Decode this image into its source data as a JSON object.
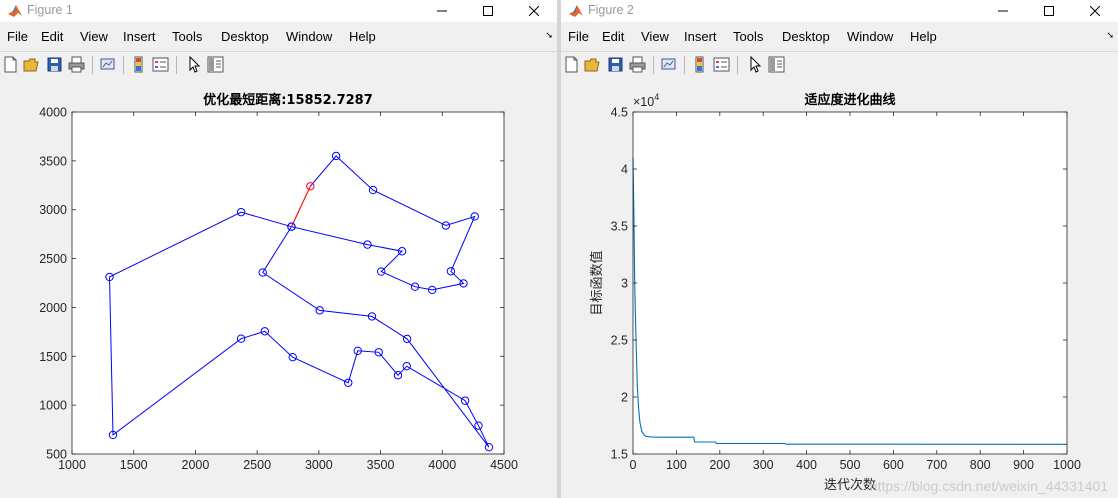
{
  "colors": {
    "route": "#0000ff",
    "route_highlight": "#ff0000",
    "curve": "#0072bd"
  },
  "figure1": {
    "title": "Figure 1",
    "menu": [
      "File",
      "Edit",
      "View",
      "Insert",
      "Tools",
      "Desktop",
      "Window",
      "Help"
    ]
  },
  "figure2": {
    "title": "Figure 2",
    "menu": [
      "File",
      "Edit",
      "View",
      "Insert",
      "Tools",
      "Desktop",
      "Window",
      "Help"
    ]
  },
  "toolbar_icons": [
    "new-figure-icon",
    "open-file-icon",
    "save-icon",
    "print-icon",
    "link-plot-icon",
    "colorbar-icon",
    "legend-icon",
    "pointer-icon",
    "property-inspector-icon"
  ],
  "watermark": "https://blog.csdn.net/weixin_44331401",
  "chart_data": [
    {
      "type": "scatter",
      "title": "优化最短距离:15852.7287",
      "xlabel": "",
      "ylabel": "",
      "xlim": [
        1000,
        4500
      ],
      "ylim": [
        500,
        4000
      ],
      "xticks": [
        1000,
        1500,
        2000,
        2500,
        3000,
        3500,
        4000,
        4500
      ],
      "yticks": [
        500,
        1000,
        1500,
        2000,
        2500,
        3000,
        3500,
        4000
      ],
      "grid": false,
      "route": [
        [
          2778,
          2826
        ],
        [
          2370,
          2975
        ],
        [
          1304,
          2312
        ],
        [
          1332,
          695
        ],
        [
          2370,
          1680
        ],
        [
          2562,
          1756
        ],
        [
          2788,
          1491
        ],
        [
          3238,
          1229
        ],
        [
          3315,
          1556
        ],
        [
          3485,
          1541
        ],
        [
          3641,
          1306
        ],
        [
          3712,
          1399
        ],
        [
          4185,
          1046
        ],
        [
          4293,
          790
        ],
        [
          4378,
          570
        ],
        [
          3715,
          1678
        ],
        [
          3430,
          1908
        ],
        [
          3007,
          1970
        ],
        [
          2545,
          2357
        ],
        [
          2778,
          2826
        ],
        [
          3394,
          2643
        ],
        [
          3674,
          2575
        ],
        [
          3505,
          2367
        ],
        [
          3779,
          2212
        ],
        [
          3918,
          2179
        ],
        [
          4172,
          2246
        ],
        [
          4070,
          2370
        ],
        [
          4263,
          2931
        ],
        [
          4029,
          2838
        ],
        [
          3439,
          3201
        ],
        [
          3140,
          3550
        ],
        [
          2931,
          3240
        ]
      ],
      "highlight_segment": [
        [
          2931,
          3240
        ],
        [
          2778,
          2826
        ]
      ]
    },
    {
      "type": "line",
      "title": "适应度进化曲线",
      "xlabel": "迭代次数",
      "ylabel": "目标函数值",
      "xlim": [
        0,
        1000
      ],
      "ylim": [
        15000,
        45000
      ],
      "xticks": [
        0,
        100,
        200,
        300,
        400,
        500,
        600,
        700,
        800,
        900,
        1000
      ],
      "yticks": [
        1.5,
        2,
        2.5,
        3,
        3.5,
        4,
        4.5
      ],
      "yexponent": "×10",
      "yexponent_power": "4",
      "grid": false,
      "series": [
        {
          "x": [
            0,
            2,
            4,
            6,
            8,
            10,
            13,
            16,
            20,
            25,
            30,
            40,
            50,
            60,
            100,
            140,
            142,
            190,
            192,
            350,
            352,
            1000
          ],
          "y": [
            41000,
            36000,
            30000,
            26500,
            23500,
            21000,
            19000,
            17800,
            17000,
            16700,
            16550,
            16500,
            16480,
            16470,
            16470,
            16470,
            16050,
            16050,
            15920,
            15920,
            15860,
            15853
          ]
        }
      ]
    }
  ]
}
